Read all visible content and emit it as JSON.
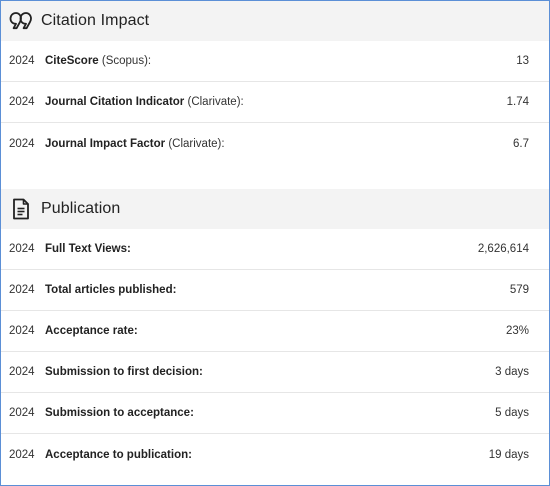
{
  "citation": {
    "title": "Citation Impact",
    "icon": "quote-icon",
    "rows": [
      {
        "year": "2024",
        "label": "CiteScore",
        "source": " (Scopus):",
        "value": "13"
      },
      {
        "year": "2024",
        "label": "Journal Citation Indicator",
        "source": " (Clarivate):",
        "value": "1.74"
      },
      {
        "year": "2024",
        "label": "Journal Impact Factor",
        "source": " (Clarivate):",
        "value": "6.7"
      }
    ]
  },
  "publication": {
    "title": "Publication",
    "icon": "document-icon",
    "rows": [
      {
        "year": "2024",
        "label": "Full Text Views:",
        "value": "2,626,614"
      },
      {
        "year": "2024",
        "label": "Total articles published:",
        "value": "579"
      },
      {
        "year": "2024",
        "label": "Acceptance rate:",
        "value": "23%"
      },
      {
        "year": "2024",
        "label": "Submission to first decision:",
        "value": "3 days"
      },
      {
        "year": "2024",
        "label": "Submission to acceptance:",
        "value": "5 days"
      },
      {
        "year": "2024",
        "label": "Acceptance to publication:",
        "value": "19 days"
      }
    ]
  }
}
